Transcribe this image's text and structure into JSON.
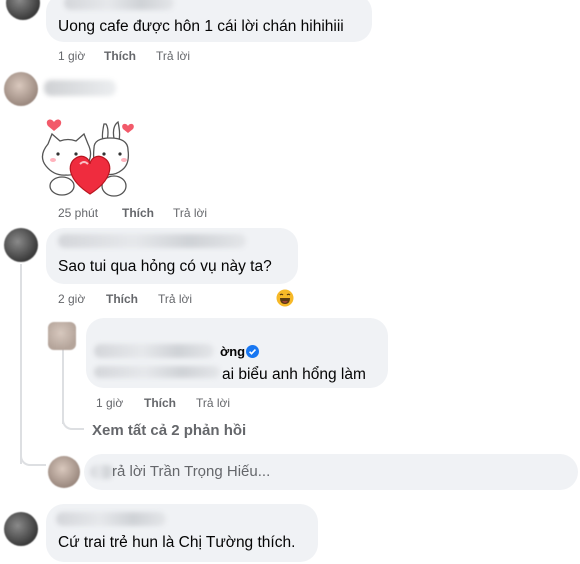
{
  "comments": [
    {
      "text": "Uong cafe được hôn 1 cái lời chán hihihiii",
      "time": "1 giờ",
      "like": "Thích",
      "reply": "Trả lời"
    },
    {
      "sticker": "cat-bunny-heart-sticker",
      "time": "25 phút",
      "like": "Thích",
      "reply": "Trả lời"
    },
    {
      "text": "Sao tui qua hỏng có vụ này ta?",
      "time": "2 giờ",
      "like": "Thích",
      "reply": "Trả lời",
      "reaction_icon": "laughing-emoji-icon",
      "nested_reply": {
        "name_suffix": "ờng",
        "text": "ai biểu anh hổng làm",
        "time": "1 giờ",
        "like": "Thích",
        "reply": "Trả lời"
      },
      "view_all": "Xem tất cả 2 phản hồi",
      "reply_placeholder": "rả lời Trần Trọng Hiếu..."
    },
    {
      "text": "Cứ trai trẻ hun là Chị Tường thích."
    }
  ],
  "colors": {
    "bubble": "#f0f2f5",
    "meta": "#65676b",
    "verified": "#1877f2"
  }
}
